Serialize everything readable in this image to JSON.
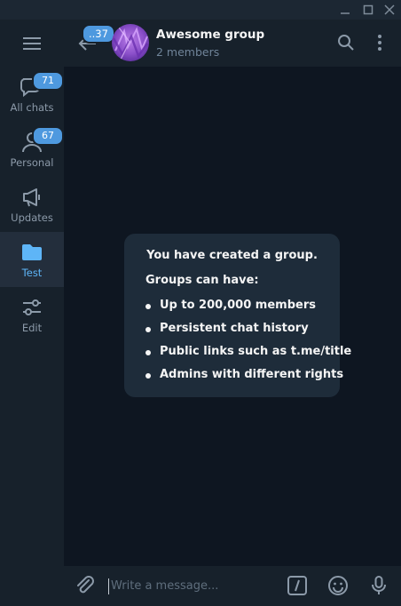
{
  "window": {
    "controls": [
      "minimize-icon",
      "maximize-icon",
      "close-icon"
    ]
  },
  "sidebar": {
    "menu_icon": "hamburger-icon",
    "folders": [
      {
        "label": "All chats",
        "icon": "chat-bubbles-icon",
        "badge": "71",
        "active": false
      },
      {
        "label": "Personal",
        "icon": "person-icon",
        "badge": "67",
        "active": false
      },
      {
        "label": "Updates",
        "icon": "megaphone-icon",
        "badge": null,
        "active": false
      },
      {
        "label": "Test",
        "icon": "folder-icon",
        "badge": null,
        "active": true
      },
      {
        "label": "Edit",
        "icon": "sliders-icon",
        "badge": null,
        "active": false
      }
    ]
  },
  "header": {
    "back_badge": "..37",
    "title": "Awesome group",
    "subtitle": "2 members",
    "icons": [
      "search-icon",
      "more-vertical-icon"
    ]
  },
  "service_message": {
    "title": "You have created a group.",
    "subtitle": "Groups can have:",
    "items": [
      "Up to 200,000 members",
      "Persistent chat history",
      "Public links such as t.me/title",
      "Admins with different rights"
    ]
  },
  "composer": {
    "placeholder": "Write a message...",
    "icons": [
      "paperclip-icon",
      "bot-command-icon",
      "emoji-icon",
      "microphone-icon"
    ]
  },
  "colors": {
    "background": "#0e1621",
    "panel": "#17212b",
    "accent": "#4e99df",
    "active_label": "#5eb5f7"
  }
}
